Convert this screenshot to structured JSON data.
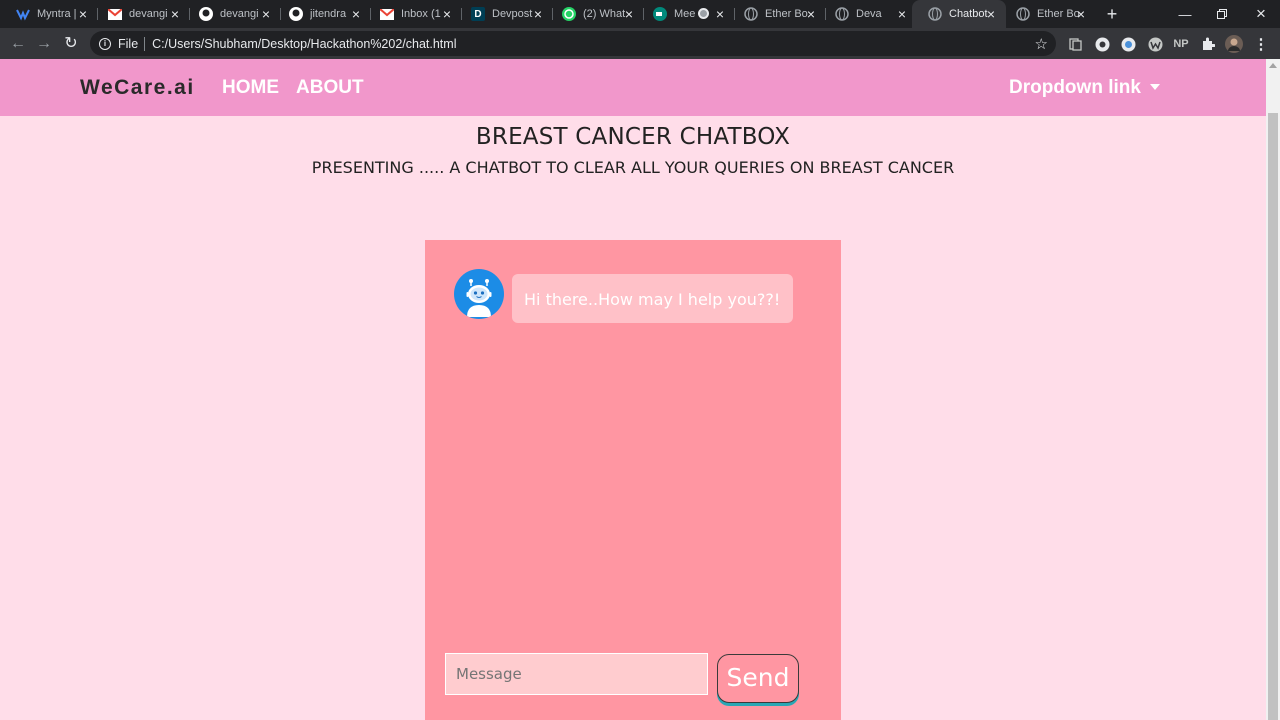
{
  "browser": {
    "tabs": [
      {
        "title": "Myntra |",
        "icon": "myntra-icon",
        "color": "#4285f4"
      },
      {
        "title": "devangi",
        "icon": "gmail-icon",
        "color": "#ea4335"
      },
      {
        "title": "devangi",
        "icon": "github-icon",
        "color": "#ffffff"
      },
      {
        "title": "jitendra",
        "icon": "github-icon",
        "color": "#ffffff"
      },
      {
        "title": "Inbox (1",
        "icon": "gmail-icon",
        "color": "#ea4335"
      },
      {
        "title": "Devpost",
        "icon": "devpost-icon",
        "color": "#003e54"
      },
      {
        "title": "(2) What",
        "icon": "whatsapp-icon",
        "color": "#25d366"
      },
      {
        "title": "Mee",
        "icon": "meet-icon",
        "color": "#00897b"
      },
      {
        "title": "Ether Bo",
        "icon": "globe-icon",
        "color": "#9aa0a6"
      },
      {
        "title": "Deva",
        "icon": "globe-icon",
        "color": "#9aa0a6"
      },
      {
        "title": "Chatbot",
        "icon": "globe-icon",
        "color": "#9aa0a6",
        "active": true
      },
      {
        "title": "Ether Bo",
        "icon": "globe-icon",
        "color": "#9aa0a6"
      }
    ],
    "address": {
      "scheme_label": "File",
      "url": "C:/Users/Shubham/Desktop/Hackathon%202/chat.html"
    },
    "extensions": [
      "NP"
    ]
  },
  "site": {
    "brand": "WeCare.ai",
    "nav": {
      "home": "HOME",
      "about": "ABOUT",
      "dropdown": "Dropdown link"
    },
    "heading": "BREAST CANCER CHATBOX",
    "subheading": "PRESENTING ..... A CHATBOT TO CLEAR ALL YOUR QUERIES ON BREAST CANCER"
  },
  "chat": {
    "messages": [
      {
        "sender": "bot",
        "text": "Hi there..How may I help you??!"
      }
    ],
    "input_placeholder": "Message",
    "send_label": "Send"
  },
  "colors": {
    "navbar": "#f197cb",
    "page_bg": "#ffdde9",
    "chatbox": "#ff96a2",
    "bubble": "#ffc1c8",
    "avatar": "#1c8ce6"
  }
}
